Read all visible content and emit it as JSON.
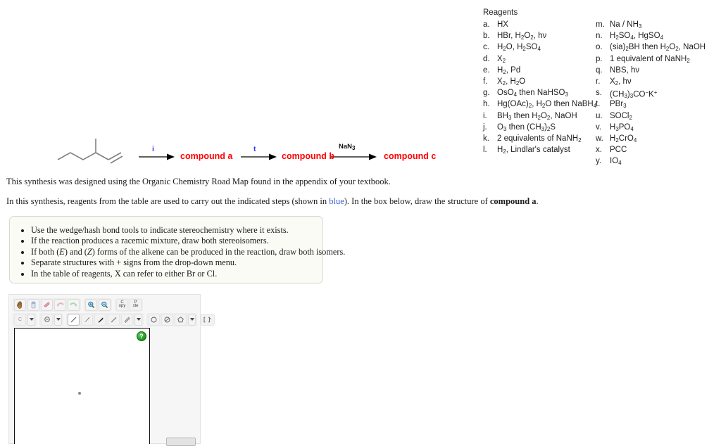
{
  "reagents": {
    "title": "Reagents",
    "left": [
      {
        "key": "a.",
        "value": "HX"
      },
      {
        "key": "b.",
        "value": "HBr, H2O2, hν"
      },
      {
        "key": "c.",
        "value": "H2O, H2SO4"
      },
      {
        "key": "d.",
        "value": "X2"
      },
      {
        "key": "e.",
        "value": "H2, Pd"
      },
      {
        "key": "f.",
        "value": "X2, H2O"
      },
      {
        "key": "g.",
        "value": "OsO4 then NaHSO3"
      },
      {
        "key": "h.",
        "value": "Hg(OAc)2, H2O then NaBH4"
      },
      {
        "key": "i.",
        "value": "BH3 then H2O2, NaOH"
      },
      {
        "key": "j.",
        "value": "O3 then (CH3)2S"
      },
      {
        "key": "k.",
        "value": "2 equivalents of NaNH2"
      },
      {
        "key": "l.",
        "value": "H2, Lindlar's catalyst"
      }
    ],
    "right": [
      {
        "key": "m.",
        "value": "Na / NH3"
      },
      {
        "key": "n.",
        "value": "H2SO4, HgSO4"
      },
      {
        "key": "o.",
        "value": "(sia)2BH then H2O2, NaOH"
      },
      {
        "key": "p.",
        "value": "1 equivalent of NaNH2"
      },
      {
        "key": "q.",
        "value": "NBS, hν"
      },
      {
        "key": "r.",
        "value": "X2, hν"
      },
      {
        "key": "s.",
        "value": "(CH3)3CO-K+"
      },
      {
        "key": "t.",
        "value": "PBr3"
      },
      {
        "key": "u.",
        "value": "SOCl2"
      },
      {
        "key": "v.",
        "value": "H3PO4"
      },
      {
        "key": "w.",
        "value": "H2CrO4"
      },
      {
        "key": "x.",
        "value": "PCC"
      },
      {
        "key": "y.",
        "value": "IO4"
      }
    ]
  },
  "scheme": {
    "starting_material": "3-methyl-1-pentene skeletal structure",
    "steps": [
      {
        "reagent_label": "i",
        "reagent_color": "#3333ff",
        "product": "compound a"
      },
      {
        "reagent_label": "t",
        "reagent_color": "#3333ff",
        "product": "compound b"
      },
      {
        "reagent_label": "NaN3",
        "reagent_color": "#111111",
        "product": "compound c"
      }
    ]
  },
  "paragraphs": {
    "p1": "This synthesis was designed using the Organic Chemistry Road Map found in the appendix of your textbook.",
    "p2_a": "In this synthesis, reagents from the table are used to carry out the indicated steps (shown in ",
    "p2_blue": "blue",
    "p2_b": "). In the box below, draw the structure of ",
    "p2_bold": "compound a",
    "p2_c": "."
  },
  "instructions": {
    "items": [
      "Use the wedge/hash bond tools to indicate stereochemistry where it exists.",
      "If the reaction produces a racemic mixture, draw both stereoisomers.",
      "If both (E) and (Z) forms of the alkene can be produced in the reaction, draw both isomers.",
      "Separate structures with + signs from the drop-down menu.",
      "In the table of reagents, X can refer to either Br or Cl."
    ]
  },
  "editor": {
    "toolbar_row1": [
      {
        "name": "pan-hand-icon",
        "label": ""
      },
      {
        "name": "eraser-icon",
        "label": ""
      },
      {
        "name": "marquee-select-icon",
        "label": ""
      },
      {
        "name": "undo-icon",
        "label": ""
      },
      {
        "name": "redo-icon",
        "label": ""
      },
      {
        "name": "zoom-in-icon",
        "label": ""
      },
      {
        "name": "zoom-out-icon",
        "label": ""
      },
      {
        "name": "copy-icon",
        "label": "C opy"
      },
      {
        "name": "paste-icon",
        "label": "P aste"
      }
    ],
    "toolbar_row2": [
      {
        "name": "carbon-atom-tool",
        "label": "C"
      },
      {
        "name": "charge-tool",
        "label": ""
      },
      {
        "name": "plain-bond-tool",
        "label": ""
      },
      {
        "name": "wedge-bond-tool",
        "label": ""
      },
      {
        "name": "bold-wedge-bond-tool",
        "label": ""
      },
      {
        "name": "hash-bond-tool",
        "label": ""
      },
      {
        "name": "double-bond-tool",
        "label": ""
      },
      {
        "name": "cyclopropane-ring-tool",
        "label": ""
      },
      {
        "name": "cyclobutane-ring-tool",
        "label": ""
      },
      {
        "name": "cyclopentane-ring-tool",
        "label": ""
      },
      {
        "name": "bracket-tool",
        "label": "[ ]"
      }
    ],
    "help_button_label": "?"
  },
  "colors": {
    "compound_red": "#ff0000",
    "reagent_blue": "#3333ff",
    "link_blue": "#3a5fcd",
    "help_green": "#2ba22b",
    "box_bg": "#fbfbf6"
  }
}
